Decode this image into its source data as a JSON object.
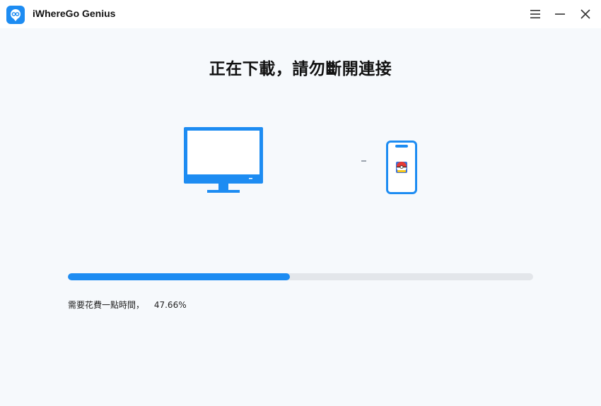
{
  "window": {
    "app_title": "iWhereGo Genius",
    "controls": {
      "menu_icon": "hamburger-menu-icon",
      "minimize_icon": "minimize-icon",
      "close_icon": "close-icon"
    }
  },
  "main": {
    "headline": "正在下載，請勿斷開連接",
    "devices": {
      "computer_icon": "monitor-icon",
      "phone_icon": "phone-icon",
      "phone_app_icon": "pokemon-go-app-icon"
    },
    "progress": {
      "percent_value": 47.66,
      "message": "需要花費一點時間，",
      "percent_label": "47.66%"
    }
  },
  "colors": {
    "accent": "#1d8cf2",
    "background": "#f6f9fc",
    "track": "#e3e6ea"
  }
}
